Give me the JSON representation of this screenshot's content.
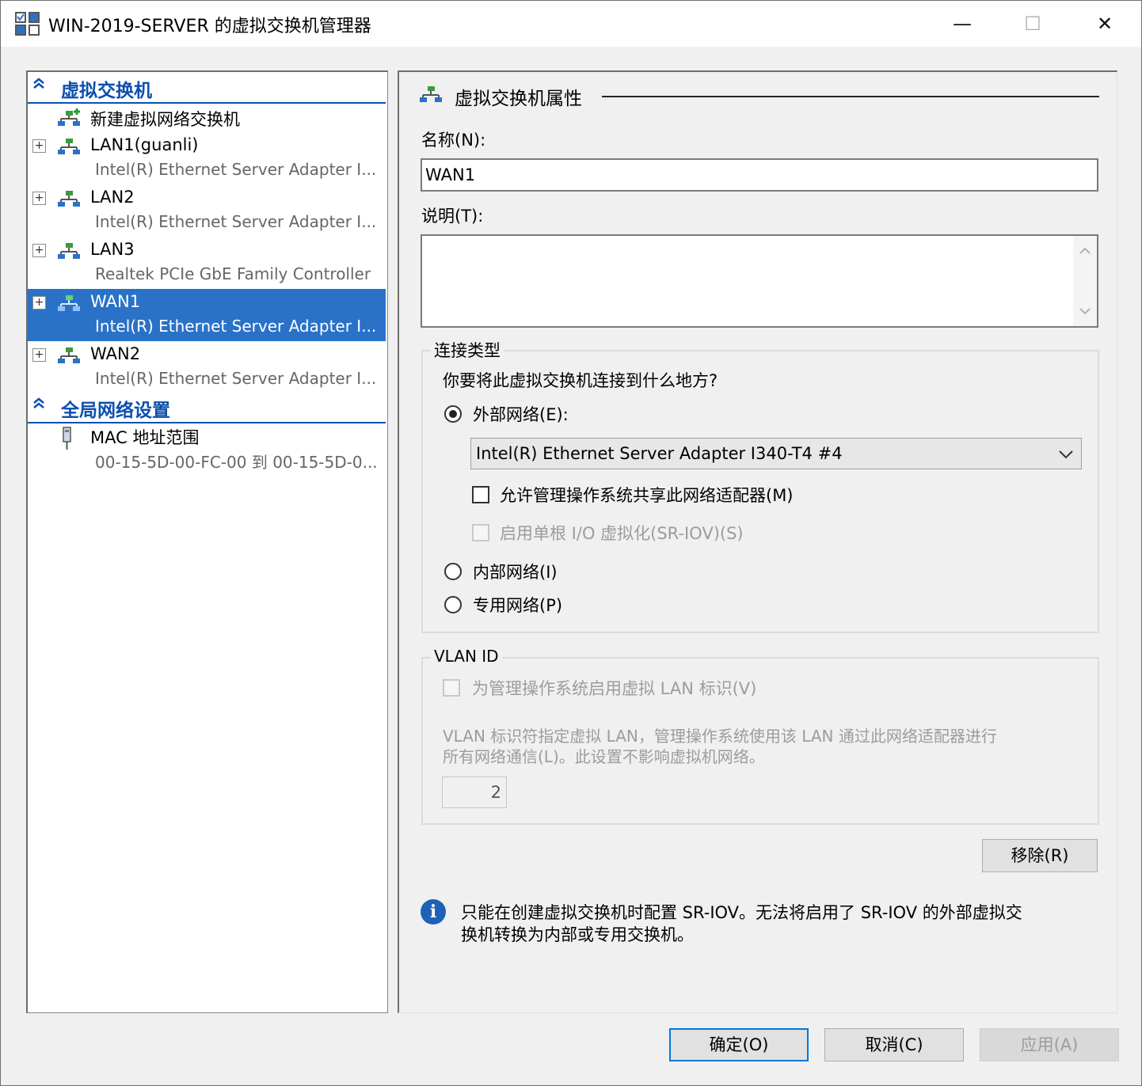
{
  "window": {
    "title": "WIN-2019-SERVER 的虚拟交换机管理器",
    "minimize_glyph": "—",
    "maximize_glyph": "☐",
    "close_glyph": "✕"
  },
  "tree": {
    "switch_section": {
      "label": "虚拟交换机",
      "chevron": "≈"
    },
    "new_switch_label": "新建虚拟网络交换机",
    "switches": [
      {
        "name": "LAN1(guanli)",
        "adapter": "Intel(R) Ethernet Server Adapter I...",
        "selected": false
      },
      {
        "name": "LAN2",
        "adapter": "Intel(R) Ethernet Server Adapter I...",
        "selected": false
      },
      {
        "name": "LAN3",
        "adapter": "Realtek PCIe GbE Family Controller",
        "selected": false
      },
      {
        "name": "WAN1",
        "adapter": "Intel(R) Ethernet Server Adapter I...",
        "selected": true
      },
      {
        "name": "WAN2",
        "adapter": "Intel(R) Ethernet Server Adapter I...",
        "selected": false
      }
    ],
    "global_section": {
      "label": "全局网络设置",
      "chevron": "≈"
    },
    "mac": {
      "title": "MAC 地址范围",
      "range": "00-15-5D-00-FC-00 到 00-15-5D-0..."
    },
    "expander_glyph": "+"
  },
  "properties": {
    "header": "虚拟交换机属性",
    "name_label": "名称(N):",
    "name_value": "WAN1",
    "notes_label": "说明(T):",
    "notes_value": "",
    "connection": {
      "group_title": "连接类型",
      "question": "你要将此虚拟交换机连接到什么地方?",
      "external_label": "外部网络(E):",
      "adapter_selected": "Intel(R) Ethernet Server Adapter I340-T4 #4",
      "allow_mgmt_share": "允许管理操作系统共享此网络适配器(M)",
      "enable_sriov": "启用单根 I/O 虚拟化(SR-IOV)(S)",
      "internal_label": "内部网络(I)",
      "private_label": "专用网络(P)",
      "selected": "external"
    },
    "vlan": {
      "group_title": "VLAN ID",
      "enable_label": "为管理操作系统启用虚拟 LAN 标识(V)",
      "description_line1": "VLAN 标识符指定虚拟 LAN，管理操作系统使用该 LAN 通过此网络适配器进行",
      "description_line2": "所有网络通信(L)。此设置不影响虚拟机网络。",
      "value": "2"
    },
    "remove_button": "移除(R)",
    "info_icon": "i",
    "info_line1": "只能在创建虚拟交换机时配置 SR-IOV。无法将启用了 SR-IOV 的外部虚拟交",
    "info_line2": "换机转换为内部或专用交换机。"
  },
  "footer": {
    "ok": "确定(O)",
    "cancel": "取消(C)",
    "apply": "应用(A)"
  }
}
